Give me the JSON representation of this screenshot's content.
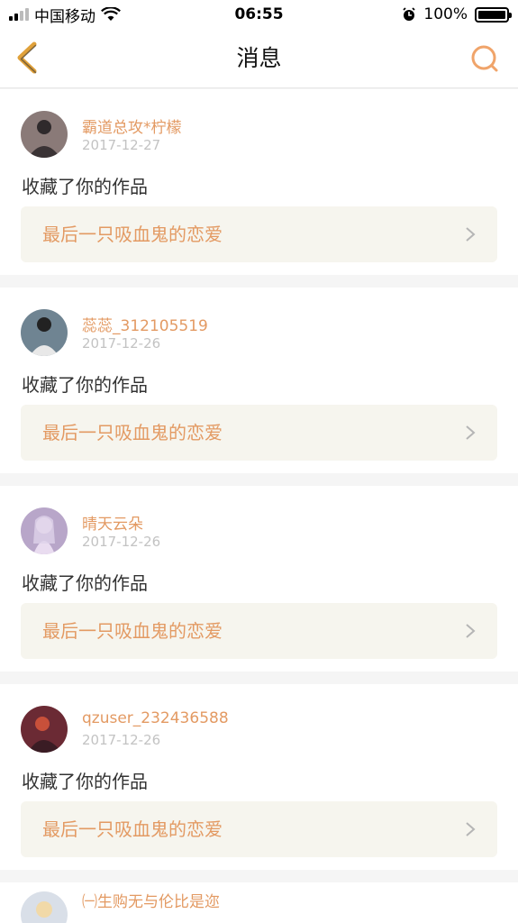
{
  "status_bar": {
    "carrier": "中国移动",
    "time": "06:55",
    "battery": "100%"
  },
  "header": {
    "title": "消息"
  },
  "messages": [
    {
      "username": "霸道总攻*柠檬",
      "date": "2017-12-27",
      "action": "收藏了你的作品",
      "work": "最后一只吸血鬼的恋爱",
      "avatar_color": "#8a7a78"
    },
    {
      "username": "蕊蕊_312105519",
      "date": "2017-12-26",
      "action": "收藏了你的作品",
      "work": "最后一只吸血鬼的恋爱",
      "avatar_color": "#6f8492"
    },
    {
      "username": "晴天云朵",
      "date": "2017-12-26",
      "action": "收藏了你的作品",
      "work": "最后一只吸血鬼的恋爱",
      "avatar_color": "#b8a6c9"
    },
    {
      "username": "qzuser_232436588",
      "date": "2017-12-26",
      "action": "收藏了你的作品",
      "work": "最后一只吸血鬼的恋爱",
      "avatar_color": "#6b2a34"
    }
  ],
  "partial_message": {
    "username": "㈠生购无与伦比是迩"
  },
  "colors": {
    "accent": "#e39a63",
    "card_link_bg": "#f6f5ee",
    "date": "#c3c3c3"
  }
}
